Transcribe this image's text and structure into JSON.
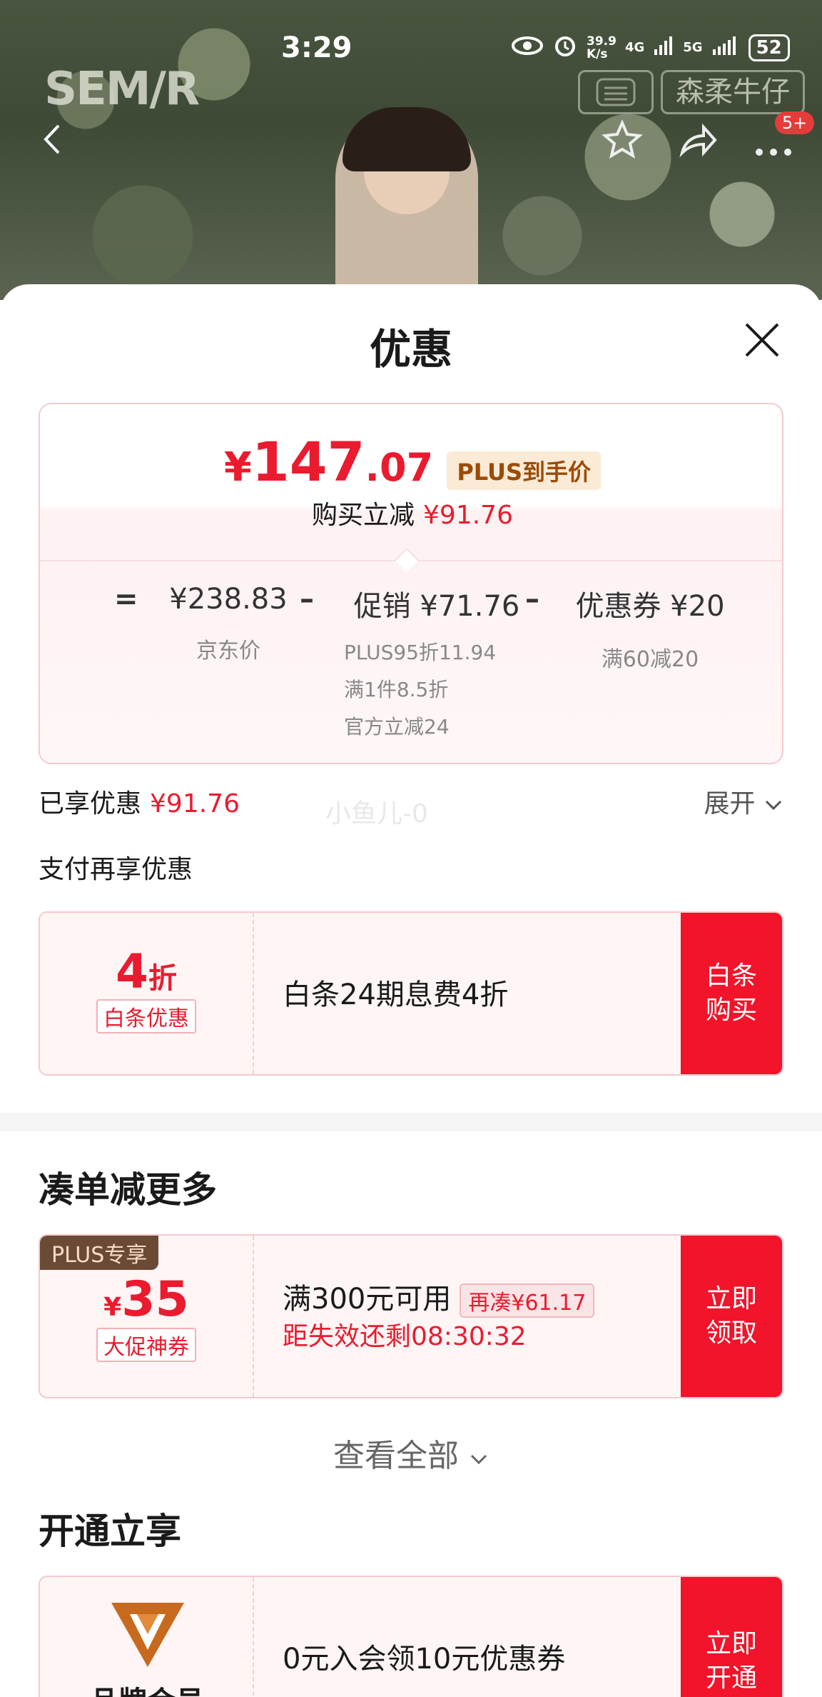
{
  "status_bar": {
    "time": "3:29",
    "speed_top": "39.9",
    "speed_bottom": "K/s",
    "net1": "4G",
    "net2": "5G",
    "battery": "52"
  },
  "header": {
    "brand_logo": "SEM/R",
    "shop_name": "森柔牛仔",
    "badge": "5+"
  },
  "sheet": {
    "title": "优惠",
    "price": {
      "currency": "¥",
      "integer": "147",
      "decimal": ".07",
      "tag": "PLUS到手价",
      "reduce_label": "购买立减",
      "reduce_value": "¥91.76"
    },
    "breakdown": {
      "eq": "=",
      "minus": "–",
      "jd_price": "¥238.83",
      "jd_label": "京东价",
      "promo_label": "促销",
      "promo_value": "¥71.76",
      "promo_items": [
        "PLUS95折11.94",
        "满1件8.5折",
        "官方立减24"
      ],
      "coupon_label": "优惠券",
      "coupon_value": "¥20",
      "coupon_detail": "满60减20"
    },
    "enjoyed_label": "已享优惠",
    "enjoyed_value": "¥91.76",
    "expand_label": "展开",
    "watermark": "小鱼儿-0",
    "pay_again": "支付再享优惠",
    "baitiao": {
      "discount_num": "4",
      "discount_unit": "折",
      "tag": "白条优惠",
      "desc": "白条24期息费4折",
      "button": "白条购买"
    },
    "section_more": "凑单减更多",
    "coupon35": {
      "plus_tag": "PLUS专享",
      "currency": "¥",
      "amount": "35",
      "tag": "大促神券",
      "condition": "满300元可用",
      "rebuy": "再凑¥61.17",
      "countdown": "距失效还剩08:30:32",
      "button": "立即领取"
    },
    "view_all": "查看全部",
    "section_open": "开通立享",
    "member": {
      "name": "品牌会员",
      "desc": "0元入会领10元优惠券",
      "button": "立即开通"
    }
  },
  "colors": {
    "accent": "#f1142a",
    "price_red": "#ea1b2f",
    "plus_gold": "#9a4c07"
  }
}
